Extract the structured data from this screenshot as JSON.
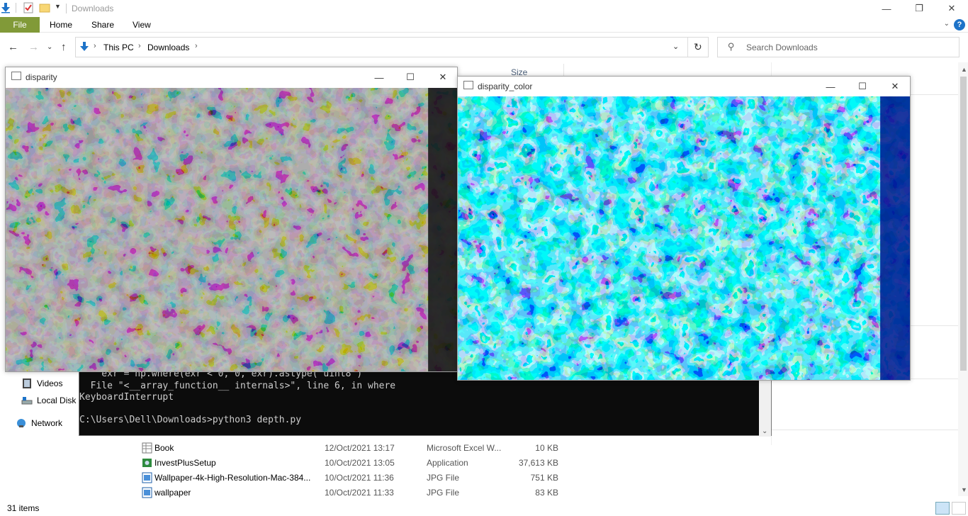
{
  "explorer": {
    "title": "Downloads",
    "ribbon_tabs": [
      "File",
      "Home",
      "Share",
      "View"
    ],
    "breadcrumb": [
      "This PC",
      "Downloads"
    ],
    "search_placeholder": "Search Downloads",
    "column_size": "Size",
    "nav_items": [
      {
        "label": "Videos",
        "icon": "videos-icon"
      },
      {
        "label": "Local Disk",
        "icon": "local-disk-icon"
      },
      {
        "label": "Network",
        "icon": "network-icon"
      }
    ],
    "files": [
      {
        "name": "Book",
        "date": "12/Oct/2021 13:17",
        "type": "Microsoft Excel W...",
        "size": "10 KB",
        "icon": "excel-icon"
      },
      {
        "name": "InvestPlusSetup",
        "date": "10/Oct/2021 13:05",
        "type": "Application",
        "size": "37,613 KB",
        "icon": "installer-icon"
      },
      {
        "name": "Wallpaper-4k-High-Resolution-Mac-384...",
        "date": "10/Oct/2021 11:36",
        "type": "JPG File",
        "size": "751 KB",
        "icon": "image-icon"
      },
      {
        "name": "wallpaper",
        "date": "10/Oct/2021 11:33",
        "type": "JPG File",
        "size": "83 KB",
        "icon": "image-icon"
      }
    ],
    "status": "31 items"
  },
  "console": {
    "lines": [
      "    exr = np.where(exr < 0, 0, exr).astype('uint8')",
      "  File \"<__array_function__ internals>\", line 6, in where",
      "KeyboardInterrupt",
      "",
      "C:\\Users\\Dell\\Downloads>python3 depth.py"
    ]
  },
  "disparity_window": {
    "title": "disparity"
  },
  "disparity_color_window": {
    "title": "disparity_color"
  },
  "colors": {
    "file_tab": "#819a38",
    "console_bg": "#0c0c0c",
    "console_text": "#cccccc"
  }
}
